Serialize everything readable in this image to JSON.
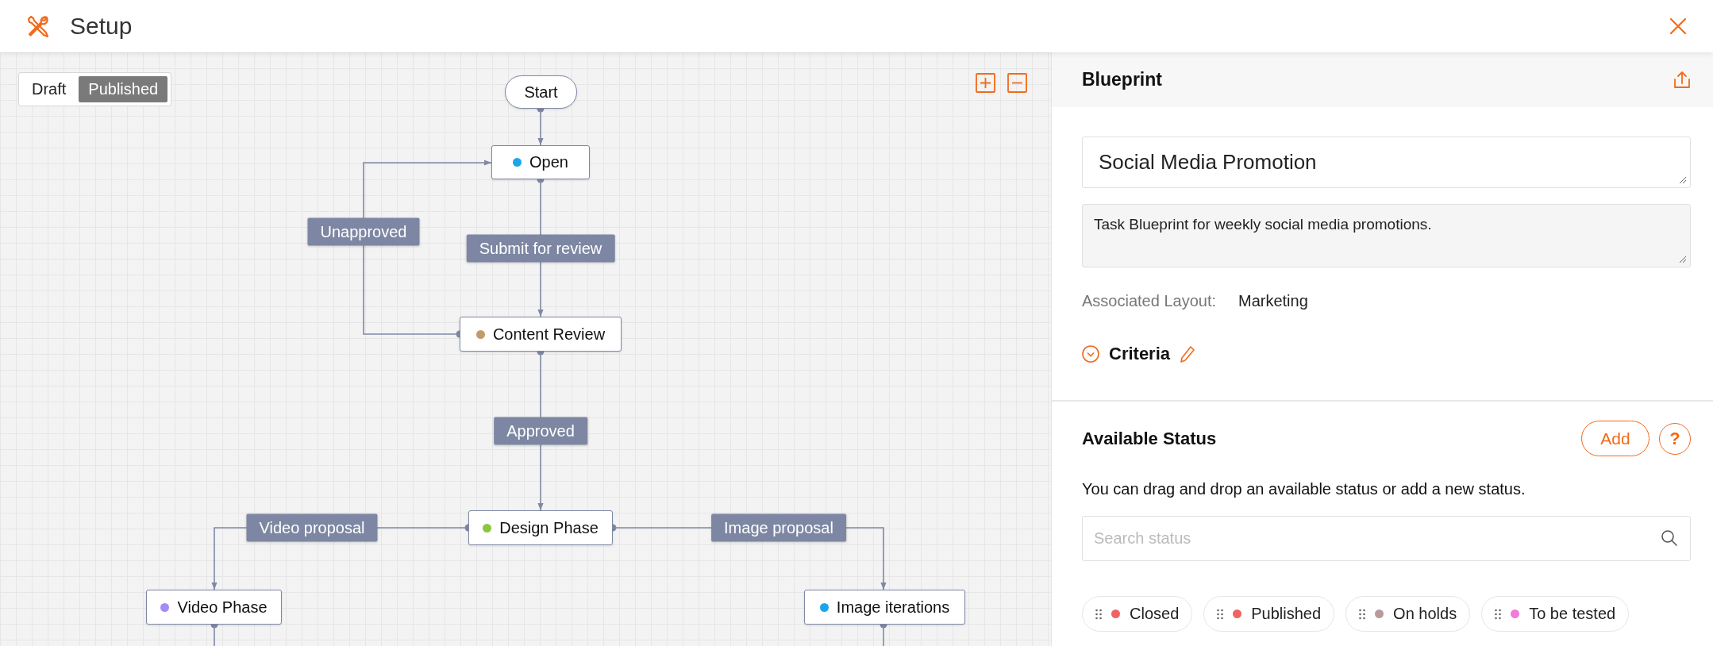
{
  "header": {
    "title": "Setup"
  },
  "canvas": {
    "view_toggle": [
      {
        "label": "Draft",
        "selected": false
      },
      {
        "label": "Published",
        "selected": true
      }
    ],
    "nodes": [
      {
        "kind": "terminal",
        "label": "Start"
      },
      {
        "kind": "status",
        "label": "Open",
        "color": "#1ba6ea"
      },
      {
        "kind": "status",
        "label": "Content Review",
        "color": "#c49a6c"
      },
      {
        "kind": "status",
        "label": "Design Phase",
        "color": "#8cc63f"
      },
      {
        "kind": "status",
        "label": "Video Phase",
        "color": "#a48cf4"
      },
      {
        "kind": "status",
        "label": "Image iterations",
        "color": "#1ba6ea"
      }
    ],
    "transitions": [
      {
        "label": "Unapproved"
      },
      {
        "label": "Submit for review"
      },
      {
        "label": "Approved"
      },
      {
        "label": "Video proposal"
      },
      {
        "label": "Image proposal"
      }
    ]
  },
  "blueprint_panel": {
    "title": "Blueprint",
    "name_field": {
      "value": "Social Media Promotion"
    },
    "description_field": {
      "value": "Task Blueprint for weekly social media promotions."
    },
    "associated_layout": {
      "label": "Associated Layout:",
      "value": "Marketing"
    },
    "criteria": {
      "label": "Criteria"
    }
  },
  "available_status": {
    "title": "Available Status",
    "add_button": "Add",
    "help_button": "?",
    "hint": "You can drag and drop an available status or add a new status.",
    "search": {
      "placeholder": "Search status"
    },
    "statuses": [
      {
        "label": "Closed",
        "color": "#ef6461"
      },
      {
        "label": "Published",
        "color": "#ef6461"
      },
      {
        "label": "On holds",
        "color": "#b99a9a"
      },
      {
        "label": "To be tested",
        "color": "#f27ad9"
      }
    ]
  }
}
